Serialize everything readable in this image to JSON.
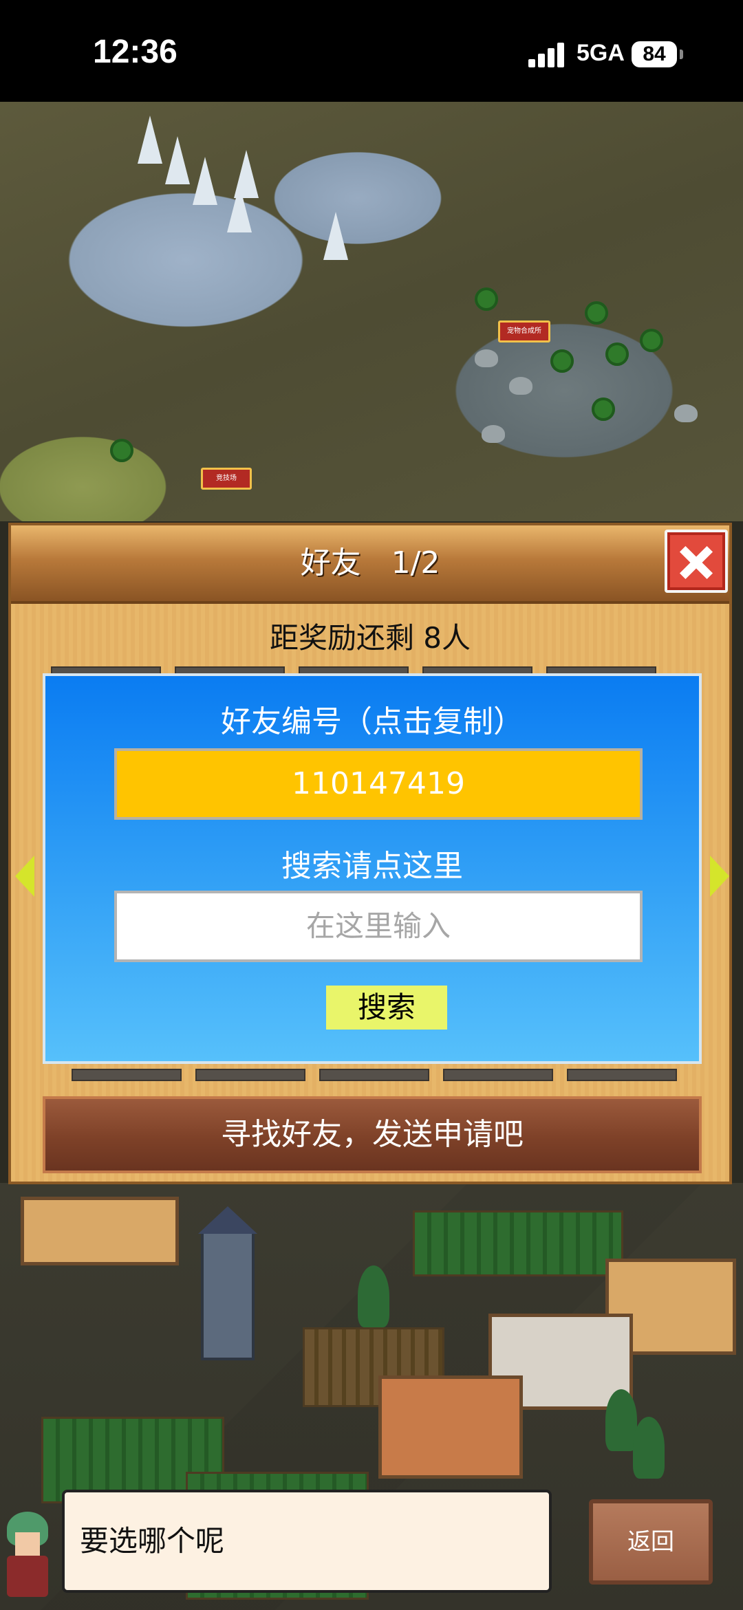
{
  "status_bar": {
    "time": "12:36",
    "network": "5GA",
    "battery": "84"
  },
  "map": {
    "label_1": "宠物合成所",
    "label_2": "竞技场"
  },
  "dialog": {
    "title": "好友　1/2",
    "reward_text": "距奖励还剩 8人",
    "friend_code_label": "好友编号（点击复制）",
    "friend_code": "110147419",
    "search_label": "搜索请点这里",
    "search_placeholder": "在这里输入",
    "search_button": "搜索",
    "find_friends_button": "寻找好友，发送申请吧"
  },
  "bottom": {
    "chat_text": "要选哪个呢",
    "back_button": "返回"
  },
  "colors": {
    "panel_blue": "#0a7cf2",
    "code_yellow": "#ffc400",
    "close_red": "#e24a3c",
    "find_button_brown": "#7e4128"
  }
}
